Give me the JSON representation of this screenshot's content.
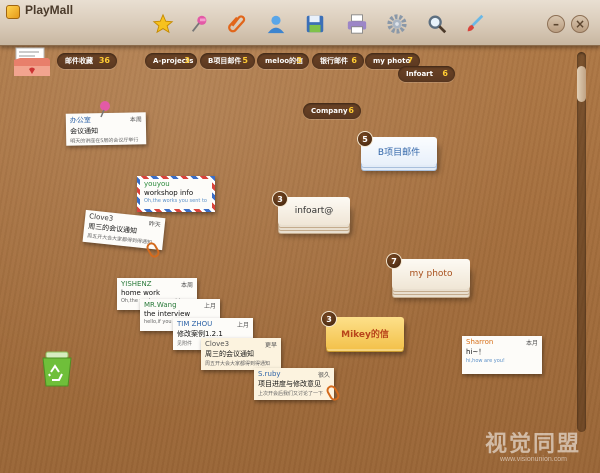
{
  "app": {
    "title": "PlayMall"
  },
  "toolbar": {
    "icons": [
      "star-icon",
      "pin-icon",
      "paperclip-icon",
      "contacts-icon",
      "save-icon",
      "print-icon",
      "gear-icon",
      "search-icon",
      "brush-icon"
    ]
  },
  "inbox": {
    "label": "邮件收藏",
    "count": "36"
  },
  "tags": [
    {
      "label": "A-projects",
      "count": "3"
    },
    {
      "label": "B项目邮件",
      "count": "5"
    },
    {
      "label": "meloo的信",
      "count": "3"
    },
    {
      "label": "银行邮件",
      "count": "6"
    },
    {
      "label": "my photo",
      "count": "7"
    },
    {
      "label": "Infoart",
      "count": "6"
    },
    {
      "label": "Company",
      "count": "6"
    }
  ],
  "stacks": [
    {
      "label": "B项目邮件",
      "count": "5"
    },
    {
      "label": "infoart@",
      "count": "3"
    },
    {
      "label": "my photo",
      "count": "7"
    },
    {
      "label": "Mikey的信",
      "count": "3"
    }
  ],
  "notes": [
    {
      "from": "办公室",
      "when": "本周",
      "subject": "会议通知",
      "preview": "明天的讲座在5层的会议厅举行"
    },
    {
      "from": "youyou",
      "when": "",
      "subject": "workshop info",
      "preview": "Oh,the works you sent to"
    },
    {
      "from": "Clove3",
      "when": "昨天",
      "subject": "周三的会议通知",
      "preview": "周五开大会大家都得到得通知"
    },
    {
      "from": "YISHENZ",
      "when": "本周",
      "subject": "home work",
      "preview": "Oh,the works you sent to"
    },
    {
      "from": "MR.Wang",
      "when": "上月",
      "subject": "the interview",
      "preview": "hello,if you"
    },
    {
      "from": "TIM ZHOU",
      "when": "上月",
      "subject": "修改案例1.2.1",
      "preview": "见附件"
    },
    {
      "from": "Clove3",
      "when": "更早",
      "subject": "周三的会议通知",
      "preview": "周五开大会大家都得到得通知"
    },
    {
      "from": "S.ruby",
      "when": "很久",
      "subject": "项目进度与修改意见",
      "preview": "上次开会后我们又讨论了一下"
    },
    {
      "from": "Sharron",
      "when": "本月",
      "subject": "hi~！",
      "preview": "hi,how are you!"
    }
  ],
  "other_icons": [
    "recycle-bin-icon",
    "minimize-icon",
    "close-icon"
  ],
  "window": {
    "minimize_label": "–",
    "close_label": "×"
  },
  "watermark": {
    "text": "视觉同盟",
    "sub": "www.visionunion.com"
  }
}
